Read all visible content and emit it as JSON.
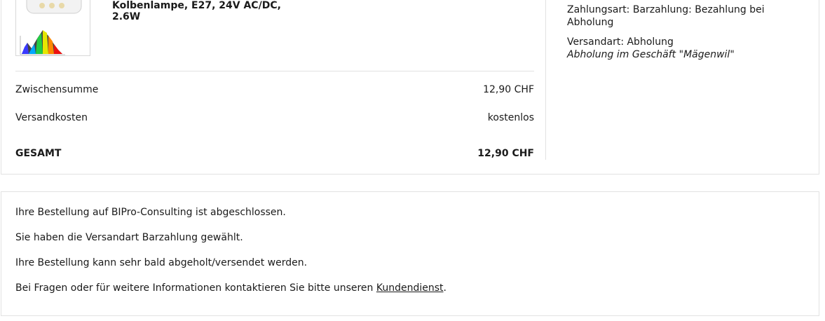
{
  "product": {
    "name_line1": "Kolbenlampe, E27, 24V AC/DC,",
    "name_line2": "2.6W"
  },
  "summary": {
    "subtotal_label": "Zwischensumme",
    "subtotal_value": "12,90 CHF",
    "shipping_label": "Versandkosten",
    "shipping_value": "kostenlos",
    "total_label": "GESAMT",
    "total_value": "12,90 CHF"
  },
  "details": {
    "payment": "Zahlungsart: Barzahlung: Bezahlung bei Abholung",
    "shipping_method": "Versandart: Abholung",
    "shipping_detail": "Abholung im Geschäft \"Mägenwil\""
  },
  "confirmation": {
    "line1": "Ihre Bestellung auf BIPro-Consulting ist abgeschlossen.",
    "line2": "Sie haben die Versandart Barzahlung gewählt.",
    "line3": "Ihre Bestellung kann sehr bald abgeholt/versendet werden.",
    "line4_prefix": "Bei Fragen oder für weitere Informationen kontaktieren Sie bitte unseren ",
    "line4_link": "Kundendienst",
    "line4_suffix": "."
  }
}
